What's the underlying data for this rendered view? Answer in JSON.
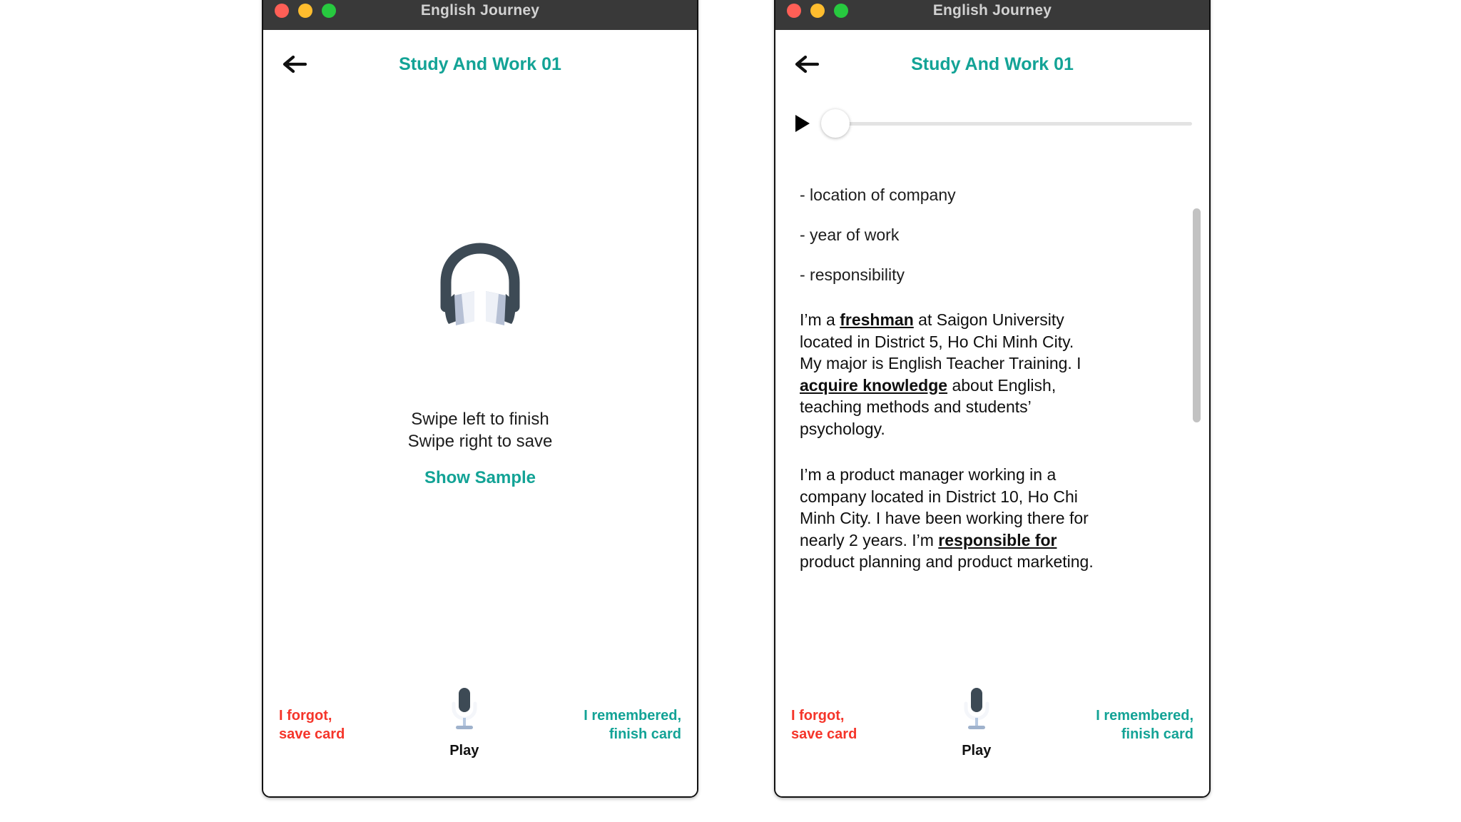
{
  "window": {
    "title": "English Journey",
    "traffic_lights": [
      "close-red",
      "minimize-yellow",
      "maximize-green"
    ],
    "colors": {
      "close": "#ff5f56",
      "minimize": "#ffbd2e",
      "maximize": "#27c93f",
      "titlebar": "#393939",
      "title_text": "#d2d2d2"
    }
  },
  "theme": {
    "accent_teal": "#13a396",
    "danger_red": "#f5352a",
    "body_text": "#1d1d1d",
    "scrollbar": "#c2c2c2"
  },
  "nav": {
    "back_icon": "arrow-left-icon",
    "screen_title": "Study And Work 01"
  },
  "left_panel": {
    "headphone_icon": "headphones-icon",
    "swipe_hint_line1": "Swipe left to finish",
    "swipe_hint_line2": "Swipe right to save",
    "show_sample_label": "Show Sample"
  },
  "right_panel": {
    "player": {
      "play_icon": "play-triangle-icon",
      "progress_percent": 0,
      "thumb_position": "start"
    },
    "clipped_line": "",
    "bullets": [
      "- location of company",
      "- year of work",
      "- responsibility"
    ],
    "paragraphs": [
      {
        "segments": [
          {
            "text": "I’m a ",
            "bold": false
          },
          {
            "text": "freshman",
            "bold": true
          },
          {
            "text": " at Saigon University located in District 5, Ho Chi Minh City. My major is English Teacher Training. I ",
            "bold": false
          },
          {
            "text": "acquire knowledge",
            "bold": true
          },
          {
            "text": " about English, teaching methods and students’ psychology.",
            "bold": false
          }
        ]
      },
      {
        "segments": [
          {
            "text": "I’m a product manager working in a company located in District 10, Ho Chi Minh City. I have been working there for nearly 2 years. I’m ",
            "bold": false
          },
          {
            "text": "responsible for",
            "bold": true
          },
          {
            "text": " product planning and product marketing.",
            "bold": false
          }
        ]
      }
    ],
    "scrollbar_visible": true
  },
  "actions": {
    "forgot_label": "I forgot,\nsave card",
    "remember_label": "I remembered,\nfinish card",
    "mic_icon": "microphone-icon",
    "play_label": "Play"
  }
}
